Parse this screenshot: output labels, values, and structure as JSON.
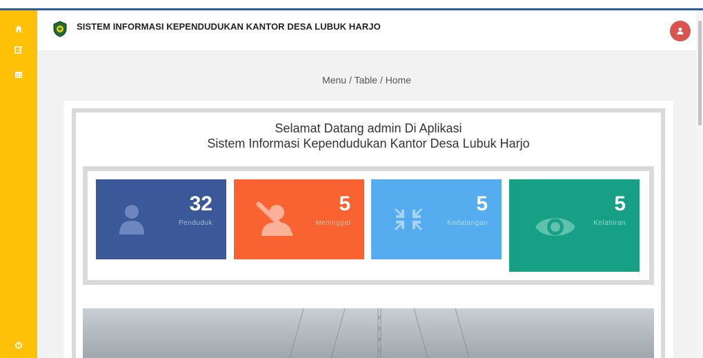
{
  "app": {
    "title": "SISTEM INFORMASI KEPENDUDUKAN KANTOR DESA LUBUK HARJO"
  },
  "sidebar": {
    "items": [
      {
        "icon": "home-icon"
      },
      {
        "icon": "edit-icon"
      },
      {
        "icon": "calendar-icon"
      }
    ],
    "bottom_icon": "power-icon"
  },
  "breadcrumb": "Menu / Table / Home",
  "welcome": {
    "line1": "Selamat Datang admin Di Aplikasi",
    "line2": "Sistem Informasi Kependudukan Kantor Desa Lubuk Harjo"
  },
  "stats": [
    {
      "value": "32",
      "label": "Penduduk",
      "icon": "user-icon",
      "color": "#3b5998"
    },
    {
      "value": "5",
      "label": "Meninggal",
      "icon": "user-slash-icon",
      "color": "#f96332"
    },
    {
      "value": "5",
      "label": "Kedatangan",
      "icon": "compress-icon",
      "color": "#55acee"
    },
    {
      "value": "5",
      "label": "Kelahiran",
      "icon": "eye-icon",
      "color": "#16a085"
    }
  ],
  "colors": {
    "sidebar": "#ffc107",
    "avatar": "#d9534f",
    "topline": "#2c5aa0"
  }
}
